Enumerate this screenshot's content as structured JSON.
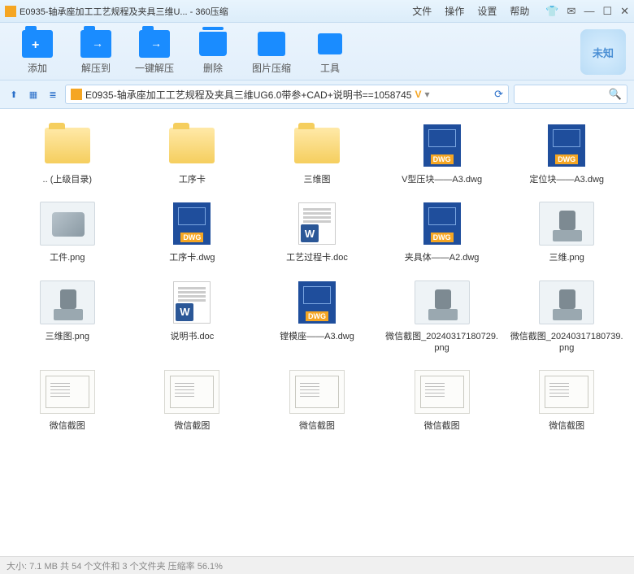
{
  "window": {
    "title": "E0935-轴承座加工工艺规程及夹具三维U... - 360压缩",
    "menu": [
      "文件",
      "操作",
      "设置",
      "帮助"
    ],
    "badge": "未知"
  },
  "toolbar": [
    {
      "label": "添加",
      "icon": "add"
    },
    {
      "label": "解压到",
      "icon": "extract"
    },
    {
      "label": "一键解压",
      "icon": "oneclick"
    },
    {
      "label": "删除",
      "icon": "delete"
    },
    {
      "label": "图片压缩",
      "icon": "image"
    },
    {
      "label": "工具",
      "icon": "tool"
    }
  ],
  "path": "E0935-轴承座加工工艺规程及夹具三维UG6.0带参+CAD+说明书==1058745",
  "files": [
    {
      "name": ".. (上级目录)",
      "type": "folder"
    },
    {
      "name": "工序卡",
      "type": "folder"
    },
    {
      "name": "三维图",
      "type": "folder"
    },
    {
      "name": "V型压块——A3.dwg",
      "type": "dwg"
    },
    {
      "name": "定位块——A3.dwg",
      "type": "dwg"
    },
    {
      "name": "工件.png",
      "type": "part"
    },
    {
      "name": "工序卡.dwg",
      "type": "dwg"
    },
    {
      "name": "工艺过程卡.doc",
      "type": "doc"
    },
    {
      "name": "夹具体——A2.dwg",
      "type": "dwg"
    },
    {
      "name": "三维.png",
      "type": "fixture"
    },
    {
      "name": "三维图.png",
      "type": "fixture"
    },
    {
      "name": "说明书.doc",
      "type": "doc"
    },
    {
      "name": "镗模座——A3.dwg",
      "type": "dwg"
    },
    {
      "name": "微信截图_20240317180729.png",
      "type": "fixture"
    },
    {
      "name": "微信截图_20240317180739.png",
      "type": "fixture"
    },
    {
      "name": "微信截图",
      "type": "draw"
    },
    {
      "name": "微信截图",
      "type": "draw"
    },
    {
      "name": "微信截图",
      "type": "draw"
    },
    {
      "name": "微信截图",
      "type": "draw"
    },
    {
      "name": "微信截图",
      "type": "draw"
    }
  ],
  "status": "大小: 7.1 MB 共 54 个文件和 3 个文件夹 压缩率 56.1%"
}
